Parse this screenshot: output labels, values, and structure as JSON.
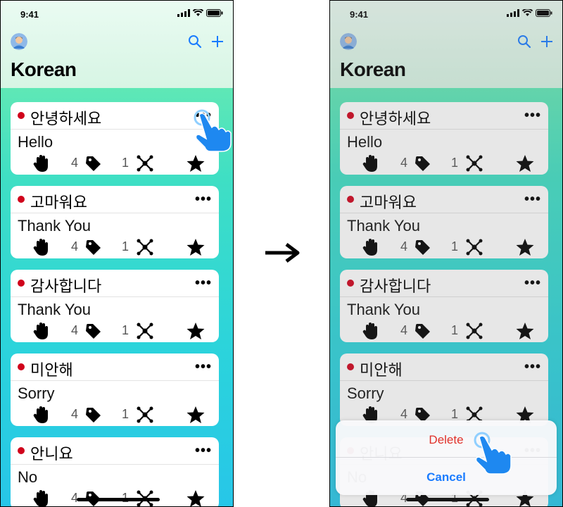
{
  "status": {
    "time": "9:41"
  },
  "header": {
    "title": "Korean"
  },
  "colors": {
    "accent": "#1a7cff",
    "dot": "#d0021b",
    "delete": "#e0312a"
  },
  "cards": [
    {
      "word": "안녕하세요",
      "meaning": "Hello",
      "tags": "4",
      "links": "1"
    },
    {
      "word": "고마워요",
      "meaning": "Thank You",
      "tags": "4",
      "links": "1"
    },
    {
      "word": "감사합니다",
      "meaning": "Thank You",
      "tags": "4",
      "links": "1"
    },
    {
      "word": "미안해",
      "meaning": "Sorry",
      "tags": "4",
      "links": "1"
    },
    {
      "word": "안니요",
      "meaning": "No",
      "tags": "4",
      "links": "1"
    }
  ],
  "more_label": "•••",
  "sheet": {
    "delete": "Delete",
    "cancel": "Cancel"
  },
  "icons": [
    "avatar",
    "search-icon",
    "plus-icon",
    "hand-icon",
    "tag-icon",
    "network-icon",
    "star-icon",
    "more-icon",
    "arrow-icon",
    "pointer-hand-icon"
  ]
}
